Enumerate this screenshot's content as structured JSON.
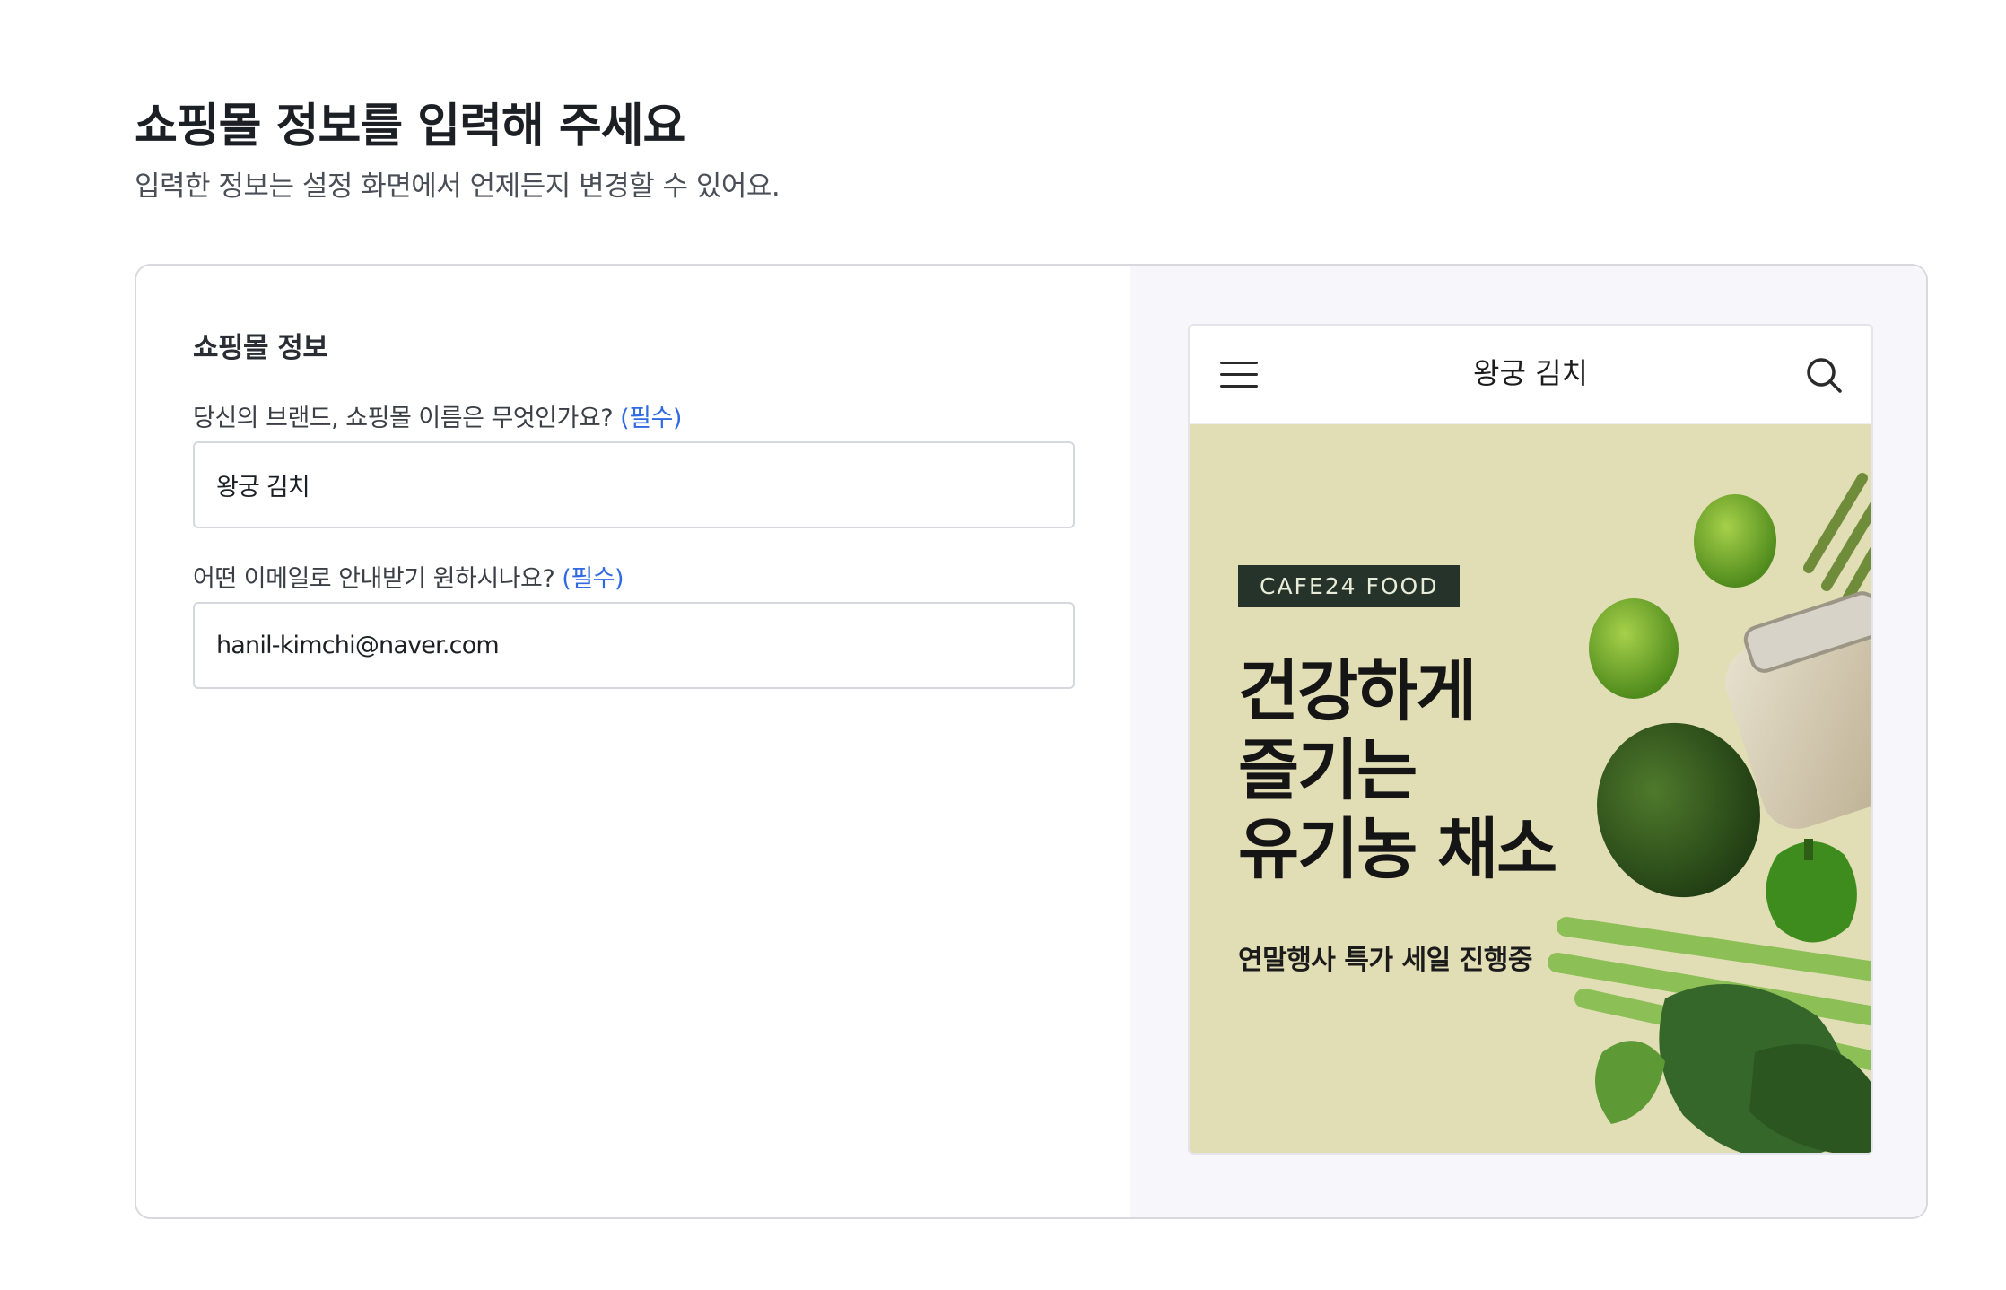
{
  "header": {
    "title": "쇼핑몰 정보를 입력해 주세요",
    "subtitle": "입력한 정보는 설정 화면에서 언제든지 변경할 수 있어요."
  },
  "form": {
    "section_title": "쇼핑몰 정보",
    "brand_field": {
      "label": "당신의 브랜드, 쇼핑몰 이름은 무엇인가요?",
      "required_label": "(필수)",
      "value": "왕궁 김치"
    },
    "email_field": {
      "label": "어떤 이메일로 안내받기 원하시나요?",
      "required_label": "(필수)",
      "value": "hanil-kimchi@naver.com"
    }
  },
  "preview": {
    "shop_name": "왕궁 김치",
    "icons": [
      "menu-icon",
      "search-icon"
    ],
    "banner": {
      "tag": "CAFE24 FOOD",
      "headline_lines": [
        "건강하게",
        "즐기는",
        "유기농 채소"
      ],
      "subtext": "연말행사 특가 세일 진행중",
      "background_color": "#e1ddb5"
    }
  },
  "colors": {
    "accent_required": "#2f6ae2",
    "border": "#d7d9de",
    "preview_bg": "#f7f7fb"
  }
}
